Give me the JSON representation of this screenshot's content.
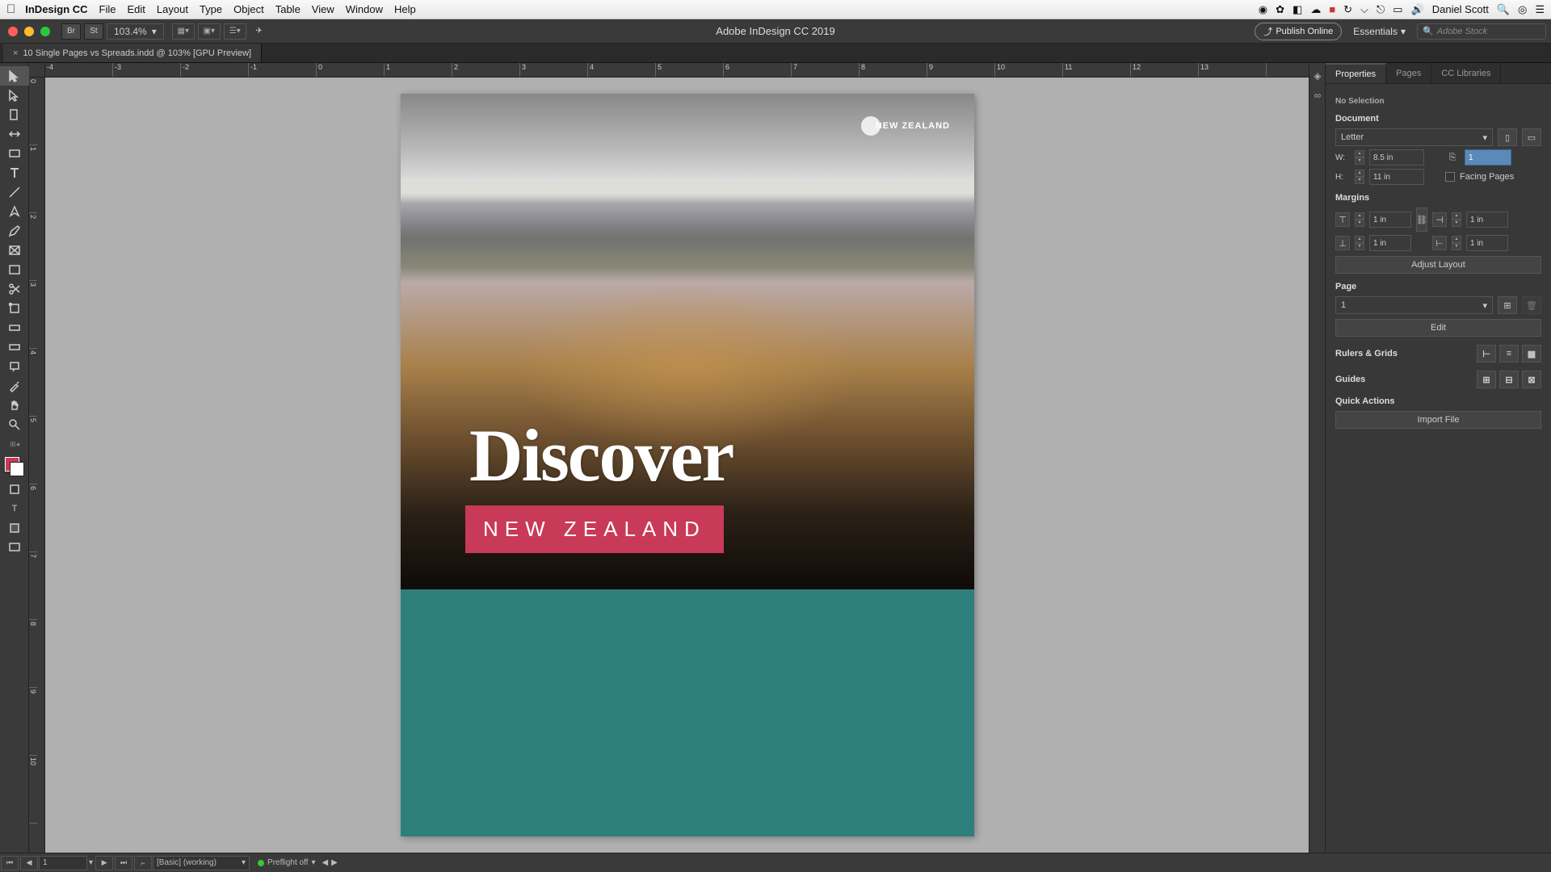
{
  "menubar": {
    "app": "InDesign CC",
    "items": [
      "File",
      "Edit",
      "Layout",
      "Type",
      "Object",
      "Table",
      "View",
      "Window",
      "Help"
    ],
    "username": "Daniel Scott"
  },
  "controlbar": {
    "zoom": "103.4%",
    "title": "Adobe InDesign CC 2019",
    "publish": "Publish Online",
    "workspace": "Essentials",
    "stock_placeholder": "Adobe Stock"
  },
  "doc_tab": {
    "title": "10 Single Pages vs Spreads.indd @ 103% [GPU Preview]"
  },
  "page_content": {
    "discover": "Discover",
    "nz": "NEW ZEALAND",
    "logo_text": "NEW ZEALAND"
  },
  "panel": {
    "tabs": [
      "Properties",
      "Pages",
      "CC Libraries"
    ],
    "selection": "No Selection",
    "section_document": "Document",
    "preset": "Letter",
    "w_label": "W:",
    "h_label": "H:",
    "w_val": "8.5 in",
    "h_val": "11 in",
    "pages_field": "1",
    "facing_pages": "Facing Pages",
    "section_margins": "Margins",
    "margin_top": "1 in",
    "margin_bottom": "1 in",
    "margin_left": "1 in",
    "margin_right": "1 in",
    "adjust_layout": "Adjust Layout",
    "section_page": "Page",
    "page_sel": "1",
    "edit_btn": "Edit",
    "rulers_grids": "Rulers & Grids",
    "guides": "Guides",
    "quick_actions": "Quick Actions",
    "import_file": "Import File"
  },
  "status": {
    "page": "1",
    "profile": "[Basic] (working)",
    "preflight": "Preflight off"
  },
  "ruler_h": [
    "-4",
    "-3",
    "-2",
    "-1",
    "0",
    "1",
    "2",
    "3",
    "4",
    "5",
    "6",
    "7",
    "8",
    "9",
    "10",
    "11",
    "12",
    "13"
  ],
  "ruler_v": [
    "0",
    "1",
    "2",
    "3",
    "4",
    "5",
    "6",
    "7",
    "8",
    "9",
    "10"
  ]
}
